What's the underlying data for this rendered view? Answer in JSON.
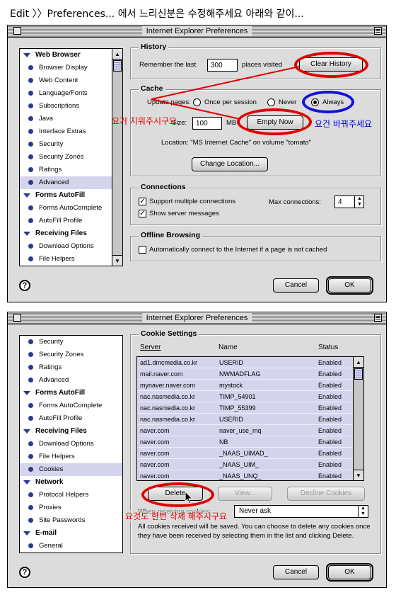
{
  "header": {
    "text": "Edit 〉〉Preferences... 에서 느리신분은 수정해주세요 아래와 같이..."
  },
  "window1": {
    "title": "Internet Explorer Preferences",
    "sidebar": [
      {
        "type": "group",
        "label": "Web Browser"
      },
      {
        "type": "item",
        "label": "Browser Display"
      },
      {
        "type": "item",
        "label": "Web Content"
      },
      {
        "type": "item",
        "label": "Language/Fonts"
      },
      {
        "type": "item",
        "label": "Subscriptions"
      },
      {
        "type": "item",
        "label": "Java"
      },
      {
        "type": "item",
        "label": "Interface Extras"
      },
      {
        "type": "item",
        "label": "Security"
      },
      {
        "type": "item",
        "label": "Security Zones"
      },
      {
        "type": "item",
        "label": "Ratings"
      },
      {
        "type": "item",
        "label": "Advanced",
        "selected": true
      },
      {
        "type": "group",
        "label": "Forms AutoFill"
      },
      {
        "type": "item",
        "label": "Forms AutoComplete"
      },
      {
        "type": "item",
        "label": "AutoFill Profile"
      },
      {
        "type": "group",
        "label": "Receiving Files"
      },
      {
        "type": "item",
        "label": "Download Options"
      },
      {
        "type": "item",
        "label": "File Helpers"
      }
    ],
    "history": {
      "title": "History",
      "remember_label": "Remember the last",
      "remember_value": "300",
      "places_label": "places visited",
      "clear_button": "Clear History"
    },
    "cache": {
      "title": "Cache",
      "update_label": "Update pages:",
      "options": [
        "Once per session",
        "Never",
        "Always"
      ],
      "selected": "Always",
      "size_label": "Size:",
      "size_value": "100",
      "size_unit": "MB",
      "empty_button": "Empty Now",
      "location_text": "Location: \"MS Internet Cache\" on volume \"tomato\"",
      "change_button": "Change Location..."
    },
    "connections": {
      "title": "Connections",
      "multi_label": "Support multiple connections",
      "messages_label": "Show server messages",
      "max_label": "Max connections:",
      "max_value": "4"
    },
    "offline": {
      "title": "Offline Browsing",
      "auto_label": "Automatically connect to the Internet if a page is not cached"
    },
    "help": "?",
    "cancel": "Cancel",
    "ok": "OK",
    "annotations": {
      "erase": "요거 지워주시구요",
      "change": "요건 바꿔주세요"
    }
  },
  "window2": {
    "title": "Internet Explorer Preferences",
    "sidebar": [
      {
        "type": "item",
        "label": "Security"
      },
      {
        "type": "item",
        "label": "Security Zones"
      },
      {
        "type": "item",
        "label": "Ratings"
      },
      {
        "type": "item",
        "label": "Advanced"
      },
      {
        "type": "group",
        "label": "Forms AutoFill"
      },
      {
        "type": "item",
        "label": "Forms AutoComplete"
      },
      {
        "type": "item",
        "label": "AutoFill Profile"
      },
      {
        "type": "group",
        "label": "Receiving Files"
      },
      {
        "type": "item",
        "label": "Download Options"
      },
      {
        "type": "item",
        "label": "File Helpers"
      },
      {
        "type": "item",
        "label": "Cookies",
        "selected": true
      },
      {
        "type": "group",
        "label": "Network"
      },
      {
        "type": "item",
        "label": "Protocol Helpers"
      },
      {
        "type": "item",
        "label": "Proxies"
      },
      {
        "type": "item",
        "label": "Site Passwords"
      },
      {
        "type": "group",
        "label": "E-mail"
      },
      {
        "type": "item",
        "label": "General"
      }
    ],
    "cookies": {
      "title": "Cookie Settings",
      "columns": [
        "Server",
        "Name",
        "Status"
      ],
      "rows": [
        [
          "ad1.dmcmedia.co.kr",
          "USERID",
          "Enabled"
        ],
        [
          "mail.naver.com",
          "NWMADFLAG",
          "Enabled"
        ],
        [
          "mynaver.naver.com",
          "mystock",
          "Enabled"
        ],
        [
          "nac.nasmedia.co.kr",
          "TIMP_54901",
          "Enabled"
        ],
        [
          "nac.nasmedia.co.kr",
          "TIMP_55399",
          "Enabled"
        ],
        [
          "nac.nasmedia.co.kr",
          "USERID",
          "Enabled"
        ],
        [
          "naver.com",
          "naver_use_mq",
          "Enabled"
        ],
        [
          "naver.com",
          "NB",
          "Enabled"
        ],
        [
          "naver.com",
          "_NAAS_UIMAD_",
          "Enabled"
        ],
        [
          "naver.com",
          "_NAAS_UIM_",
          "Enabled"
        ],
        [
          "naver.com",
          "_NAAS_UNQ_",
          "Enabled"
        ]
      ],
      "delete_button": "Delete",
      "view_button": "View...",
      "decline_button": "Decline Cookies",
      "when_label": "When receiving cookies:",
      "when_value": "Never ask",
      "description": "All cookies received will be saved.  You can choose to delete any cookies once they have been received by selecting them in the list and clicking Delete."
    },
    "help": "?",
    "cancel": "Cancel",
    "ok": "OK",
    "annotations": {
      "delete_note": "요것도 한번 삭제 해주시구요"
    }
  },
  "colors": {
    "annotation_red": "#e00000",
    "annotation_blue": "#1010e0",
    "selection": "#d4d4ec"
  }
}
